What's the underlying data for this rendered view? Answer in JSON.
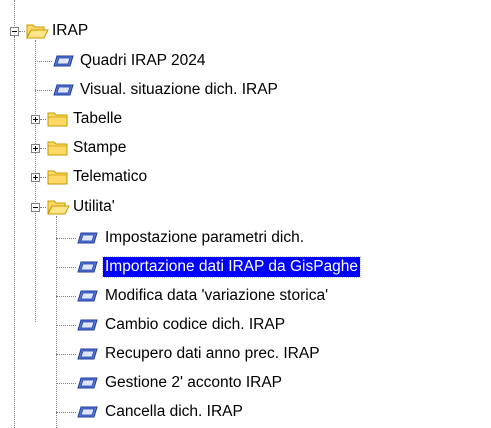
{
  "tree": {
    "root": {
      "label": "IRAP",
      "icon": "open-folder-icon",
      "expanded": true,
      "children": [
        {
          "label": "Quadri IRAP 2024",
          "icon": "program-icon"
        },
        {
          "label": "Visual. situazione dich. IRAP",
          "icon": "program-icon"
        },
        {
          "label": "Tabelle",
          "icon": "folder-icon",
          "expanded": false
        },
        {
          "label": "Stampe",
          "icon": "folder-icon",
          "expanded": false
        },
        {
          "label": "Telematico",
          "icon": "folder-icon",
          "expanded": false
        },
        {
          "label": "Utilita'",
          "icon": "open-folder-icon",
          "expanded": true,
          "children": [
            {
              "label": "Impostazione parametri dich.",
              "icon": "program-icon"
            },
            {
              "label": "Importazione dati IRAP da GisPaghe",
              "icon": "program-icon",
              "selected": true
            },
            {
              "label": "Modifica data 'variazione storica'",
              "icon": "program-icon"
            },
            {
              "label": "Cambio codice dich. IRAP",
              "icon": "program-icon"
            },
            {
              "label": "Recupero dati anno prec. IRAP",
              "icon": "program-icon"
            },
            {
              "label": "Gestione 2' acconto IRAP",
              "icon": "program-icon"
            },
            {
              "label": "Cancella dich. IRAP",
              "icon": "program-icon"
            }
          ]
        }
      ]
    },
    "colors": {
      "selection_background": "#0000ff",
      "selection_text": "#ffffff",
      "folder_fill": "#ffd965",
      "folder_outline": "#c49a00",
      "program_icon_fill": "#5577dd",
      "connector_lines": "#808080"
    }
  }
}
